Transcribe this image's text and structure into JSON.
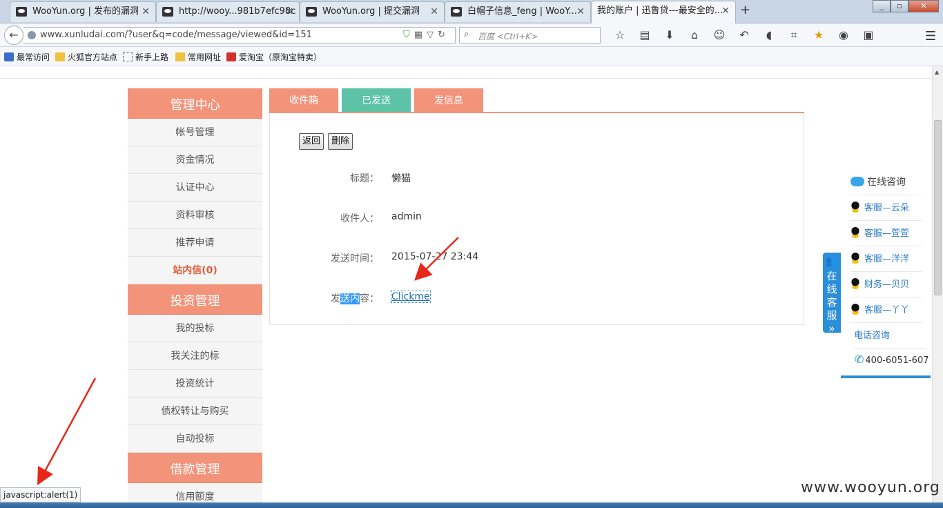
{
  "browser": {
    "tabs": [
      {
        "title": "WooYun.org | 发布的漏洞",
        "active": false
      },
      {
        "title": "http://wooy...981b7efc98c",
        "active": false
      },
      {
        "title": "WooYun.org | 提交漏洞",
        "active": false
      },
      {
        "title": "白帽子信息_feng | WooY...",
        "active": false
      },
      {
        "title": "我的账户 | 迅鲁贷---最安全的...",
        "active": true
      }
    ],
    "url": "www.xunludai.com/?user&q=code/message/viewed&id=151",
    "search_placeholder": "百度 <Ctrl+K>",
    "bookmarks": [
      "最常访问",
      "火狐官方站点",
      "新手上路",
      "常用网址",
      "爱淘宝（原淘宝特卖）"
    ],
    "status_text": "javascript:alert(1)"
  },
  "sidebar": {
    "groups": [
      {
        "title": "管理中心",
        "items": [
          "帐号管理",
          "资金情况",
          "认证中心",
          "资料审核",
          "推荐申请",
          "站内信(0)"
        ]
      },
      {
        "title": "投资管理",
        "items": [
          "我的投标",
          "我关注的标",
          "投资统计",
          "债权转让与购买",
          "自动投标"
        ]
      },
      {
        "title": "借款管理",
        "items": [
          "信用额度"
        ]
      }
    ],
    "active_item": "站内信(0)"
  },
  "message_tabs": [
    "收件箱",
    "已发送",
    "发信息"
  ],
  "active_tab": "已发送",
  "buttons": {
    "back": "返回",
    "delete": "删除"
  },
  "message": {
    "title_label": "标题：",
    "title_value": "懒猫",
    "recipient_label": "收件人：",
    "recipient_value": "admin",
    "time_label": "发送时间：",
    "time_value": "2015-07-27 23:44",
    "content_label_pre": "发",
    "content_label_sel": "送内",
    "content_label_post": "容：",
    "content_value": "Clickme"
  },
  "service": {
    "header": "在线咨询",
    "handle_text": "在线客服",
    "agents": [
      "客服—云朵",
      "客服—萱萱",
      "客服—洋洋",
      "财务—贝贝",
      "客服—丫丫"
    ],
    "phone_label": "电话咨询",
    "phone": "400-6051-607"
  },
  "watermark": "www.wooyun.org",
  "colors": {
    "salmon": "#f2937a",
    "teal": "#5cc3a7",
    "active_red": "#e35b37",
    "link_blue": "#1a6fb8",
    "service_blue": "#2a8ed8"
  }
}
